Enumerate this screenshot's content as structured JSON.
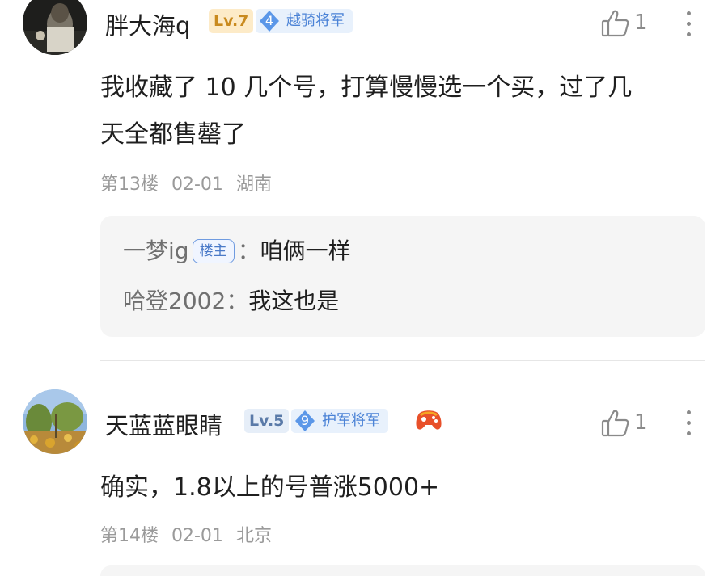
{
  "comments": [
    {
      "username": "胖大海q",
      "level": "Lv.7",
      "fan_level": "4",
      "fan_title": "越骑将军",
      "likes": "1",
      "content_lines": [
        "我收藏了 10 几个号，打算慢慢选一个买，过了几",
        "天全都售罄了"
      ],
      "floor": "第13楼",
      "date": "02-01",
      "location": "湖南",
      "replies": [
        {
          "name": "一梦ig",
          "op_tag": "楼主",
          "sep": "：",
          "text": "咱俩一样"
        },
        {
          "name": "哈登2002",
          "sep": "：",
          "text": "我这也是"
        }
      ]
    },
    {
      "username": "天蓝蓝眼睛",
      "level": "Lv.5",
      "fan_level": "9",
      "fan_title": "护军将军",
      "likes": "1",
      "content_lines": [
        "确实，1.8以上的号普涨5000+"
      ],
      "floor": "第14楼",
      "date": "02-01",
      "location": "北京"
    }
  ],
  "colors": {
    "lv7_bg": "#fdebc8",
    "lv7_text": "#c98a1e",
    "lv5_bg": "#e6eef8",
    "lv5_text": "#5a7aa8",
    "fan_bg": "#e8f1fc",
    "fan_text": "#4a82d6",
    "fan_shield": "#5b97e8"
  }
}
